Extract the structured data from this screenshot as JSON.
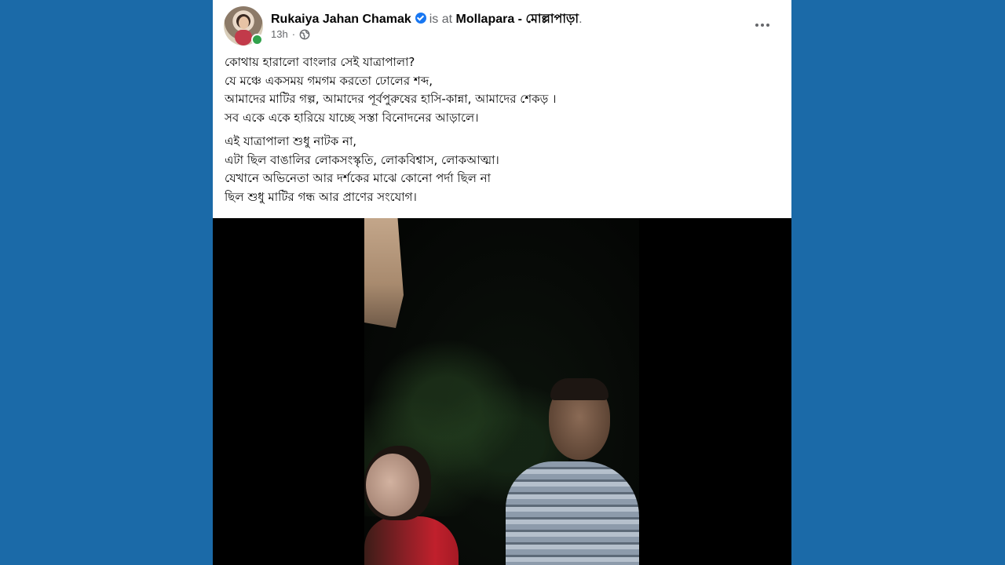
{
  "post": {
    "author_name": "Rukaiya Jahan Chamak",
    "location_prefix": "is at",
    "location": "Mollapara - মোল্লাপাড়া",
    "location_suffix": ".",
    "time": "13h",
    "privacy_icon": "globe-icon",
    "more_icon": "more-options-icon",
    "text_lines_para1": [
      "কোথায় হারালো বাংলার সেই যাত্রাপালা?",
      "যে মঞ্চে একসময় গমগম করতো ঢোলের শব্দ,",
      "আমাদের মাটির গল্প, আমাদের পূর্বপুরুষের হাসি-কান্না, আমাদের শেকড় ।",
      "সব একে একে হারিয়ে যাচ্ছে সস্তা বিনোদনের আড়ালে।"
    ],
    "text_lines_para2": [
      "এই যাত্রাপালা শুধু নাটক না,",
      "এটা ছিল বাঙালির লোকসংস্কৃতি, লোকবিশ্বাস, লোকআত্মা।",
      "যেখানে অভিনেতা আর দর্শকের মাঝে কোনো পর্দা ছিল না",
      "ছিল শুধু মাটির গন্ধ আর প্রাণের সংযোগ।"
    ]
  },
  "colors": {
    "page_background": "#1b6aa8",
    "card_background": "#ffffff",
    "verified_badge": "#1877f2",
    "online_dot": "#31a24c",
    "secondary_text": "#65676b"
  }
}
